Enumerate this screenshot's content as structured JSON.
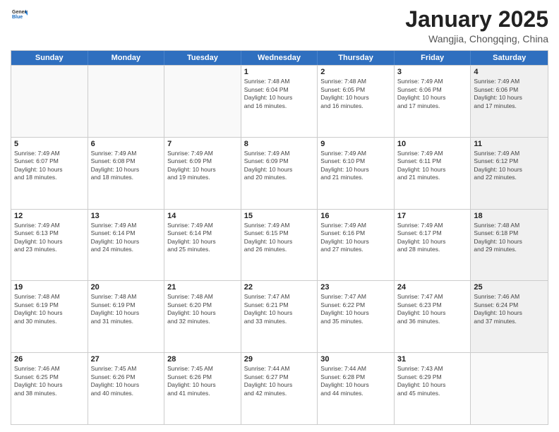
{
  "header": {
    "logo_general": "General",
    "logo_blue": "Blue",
    "month_title": "January 2025",
    "subtitle": "Wangjia, Chongqing, China"
  },
  "weekdays": [
    "Sunday",
    "Monday",
    "Tuesday",
    "Wednesday",
    "Thursday",
    "Friday",
    "Saturday"
  ],
  "rows": [
    [
      {
        "day": "",
        "info": "",
        "empty": true
      },
      {
        "day": "",
        "info": "",
        "empty": true
      },
      {
        "day": "",
        "info": "",
        "empty": true
      },
      {
        "day": "1",
        "info": "Sunrise: 7:48 AM\nSunset: 6:04 PM\nDaylight: 10 hours\nand 16 minutes."
      },
      {
        "day": "2",
        "info": "Sunrise: 7:48 AM\nSunset: 6:05 PM\nDaylight: 10 hours\nand 16 minutes."
      },
      {
        "day": "3",
        "info": "Sunrise: 7:49 AM\nSunset: 6:06 PM\nDaylight: 10 hours\nand 17 minutes."
      },
      {
        "day": "4",
        "info": "Sunrise: 7:49 AM\nSunset: 6:06 PM\nDaylight: 10 hours\nand 17 minutes.",
        "shaded": true
      }
    ],
    [
      {
        "day": "5",
        "info": "Sunrise: 7:49 AM\nSunset: 6:07 PM\nDaylight: 10 hours\nand 18 minutes."
      },
      {
        "day": "6",
        "info": "Sunrise: 7:49 AM\nSunset: 6:08 PM\nDaylight: 10 hours\nand 18 minutes."
      },
      {
        "day": "7",
        "info": "Sunrise: 7:49 AM\nSunset: 6:09 PM\nDaylight: 10 hours\nand 19 minutes."
      },
      {
        "day": "8",
        "info": "Sunrise: 7:49 AM\nSunset: 6:09 PM\nDaylight: 10 hours\nand 20 minutes."
      },
      {
        "day": "9",
        "info": "Sunrise: 7:49 AM\nSunset: 6:10 PM\nDaylight: 10 hours\nand 21 minutes."
      },
      {
        "day": "10",
        "info": "Sunrise: 7:49 AM\nSunset: 6:11 PM\nDaylight: 10 hours\nand 21 minutes."
      },
      {
        "day": "11",
        "info": "Sunrise: 7:49 AM\nSunset: 6:12 PM\nDaylight: 10 hours\nand 22 minutes.",
        "shaded": true
      }
    ],
    [
      {
        "day": "12",
        "info": "Sunrise: 7:49 AM\nSunset: 6:13 PM\nDaylight: 10 hours\nand 23 minutes."
      },
      {
        "day": "13",
        "info": "Sunrise: 7:49 AM\nSunset: 6:14 PM\nDaylight: 10 hours\nand 24 minutes."
      },
      {
        "day": "14",
        "info": "Sunrise: 7:49 AM\nSunset: 6:14 PM\nDaylight: 10 hours\nand 25 minutes."
      },
      {
        "day": "15",
        "info": "Sunrise: 7:49 AM\nSunset: 6:15 PM\nDaylight: 10 hours\nand 26 minutes."
      },
      {
        "day": "16",
        "info": "Sunrise: 7:49 AM\nSunset: 6:16 PM\nDaylight: 10 hours\nand 27 minutes."
      },
      {
        "day": "17",
        "info": "Sunrise: 7:49 AM\nSunset: 6:17 PM\nDaylight: 10 hours\nand 28 minutes."
      },
      {
        "day": "18",
        "info": "Sunrise: 7:48 AM\nSunset: 6:18 PM\nDaylight: 10 hours\nand 29 minutes.",
        "shaded": true
      }
    ],
    [
      {
        "day": "19",
        "info": "Sunrise: 7:48 AM\nSunset: 6:19 PM\nDaylight: 10 hours\nand 30 minutes."
      },
      {
        "day": "20",
        "info": "Sunrise: 7:48 AM\nSunset: 6:19 PM\nDaylight: 10 hours\nand 31 minutes."
      },
      {
        "day": "21",
        "info": "Sunrise: 7:48 AM\nSunset: 6:20 PM\nDaylight: 10 hours\nand 32 minutes."
      },
      {
        "day": "22",
        "info": "Sunrise: 7:47 AM\nSunset: 6:21 PM\nDaylight: 10 hours\nand 33 minutes."
      },
      {
        "day": "23",
        "info": "Sunrise: 7:47 AM\nSunset: 6:22 PM\nDaylight: 10 hours\nand 35 minutes."
      },
      {
        "day": "24",
        "info": "Sunrise: 7:47 AM\nSunset: 6:23 PM\nDaylight: 10 hours\nand 36 minutes."
      },
      {
        "day": "25",
        "info": "Sunrise: 7:46 AM\nSunset: 6:24 PM\nDaylight: 10 hours\nand 37 minutes.",
        "shaded": true
      }
    ],
    [
      {
        "day": "26",
        "info": "Sunrise: 7:46 AM\nSunset: 6:25 PM\nDaylight: 10 hours\nand 38 minutes."
      },
      {
        "day": "27",
        "info": "Sunrise: 7:45 AM\nSunset: 6:26 PM\nDaylight: 10 hours\nand 40 minutes."
      },
      {
        "day": "28",
        "info": "Sunrise: 7:45 AM\nSunset: 6:26 PM\nDaylight: 10 hours\nand 41 minutes."
      },
      {
        "day": "29",
        "info": "Sunrise: 7:44 AM\nSunset: 6:27 PM\nDaylight: 10 hours\nand 42 minutes."
      },
      {
        "day": "30",
        "info": "Sunrise: 7:44 AM\nSunset: 6:28 PM\nDaylight: 10 hours\nand 44 minutes."
      },
      {
        "day": "31",
        "info": "Sunrise: 7:43 AM\nSunset: 6:29 PM\nDaylight: 10 hours\nand 45 minutes."
      },
      {
        "day": "",
        "info": "",
        "empty": true,
        "shaded": true
      }
    ]
  ]
}
